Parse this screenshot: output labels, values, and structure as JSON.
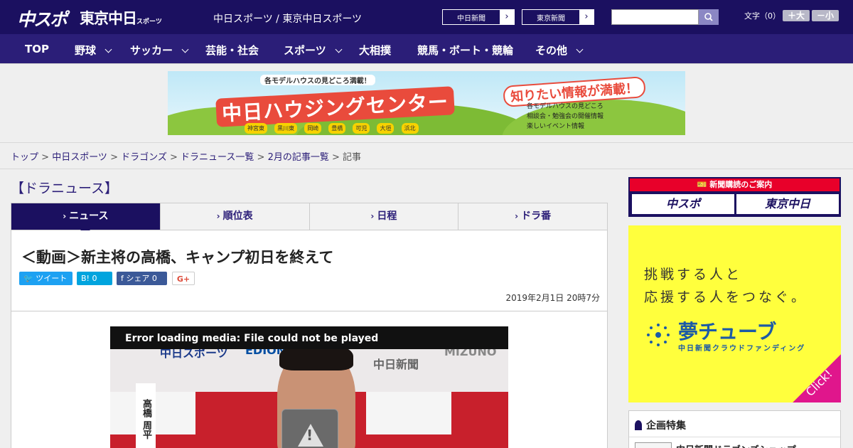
{
  "header": {
    "logo_chuspo": "中スポ",
    "logo_tokyo": "東京中日",
    "logo_tokyo_small": "スポーツ",
    "site_title": "中日スポーツ / 東京中日スポーツ",
    "paper_buttons": [
      "中日新聞",
      "東京新聞"
    ],
    "search_placeholder": "",
    "font_label": "文字（0）",
    "font_larger": "＋大",
    "font_smaller": "－小",
    "colors": {
      "topbar": "#1b1060",
      "nav": "#2b1e78"
    }
  },
  "nav": {
    "items": [
      "TOP",
      "野球",
      "サッカー",
      "芸能・社会",
      "スポーツ",
      "大相撲",
      "競馬・ボート・競輪",
      "その他"
    ]
  },
  "banner": {
    "top_text": "各モデルハウスの見どころ満載！",
    "main_text": "中日ハウジングセンター",
    "right_title": "知りたい情報が満載！",
    "info": [
      "各モデルハウスの見どころ",
      "相談会・勉強会の開催情報",
      "楽しいイベント情報"
    ],
    "towns": [
      "神宮東",
      "黒川東",
      "岡崎",
      "豊橋",
      "可児",
      "大垣",
      "浜北"
    ]
  },
  "breadcrumb": {
    "items": [
      "トップ",
      "中日スポーツ",
      "ドラゴンズ",
      "ドラニュース一覧",
      "2月の記事一覧"
    ],
    "current": "記事"
  },
  "section_title": "【ドラニュース】",
  "tabs": [
    "ニュース",
    "順位表",
    "日程",
    "ドラ番"
  ],
  "article": {
    "headline": "＜動画＞新主将の高橋、キャンプ初日を終えて",
    "share": {
      "tweet": "ツイート",
      "hatena": "B! 0",
      "facebook": "シェア 0",
      "gplus": "G+"
    },
    "date": "2019年2月1日 20時7分"
  },
  "media": {
    "error": "Error loading media: File could not be played",
    "name_strip": "高橋 周平",
    "logos": [
      "中日スポーツ",
      "EDION",
      "中日新聞",
      "MIZUNO"
    ]
  },
  "sidebar": {
    "subscribe_head": "新聞購読のご案内",
    "subscribe_buttons": [
      "中スポ",
      "東京中日"
    ],
    "ad": {
      "line1": "挑戦する人と",
      "line2": "応援する人をつなぐ。",
      "brand": "夢チューブ",
      "sub": "中日新聞クラウドファンディング",
      "click": "Click!",
      "color_bg": "#ffff3d",
      "color_corner": "#e0168c"
    },
    "feature_title": "企画特集",
    "feature_item": "中日新聞ドラゴンズショップ"
  }
}
